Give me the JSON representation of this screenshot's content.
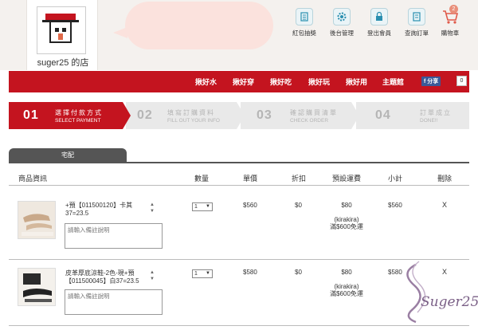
{
  "shop": {
    "name": "suger25 的店"
  },
  "top_icons": [
    {
      "label": "紅包抽獎",
      "icon": "list-icon"
    },
    {
      "label": "後台管理",
      "icon": "gear-icon"
    },
    {
      "label": "登出會員",
      "icon": "lock-icon"
    },
    {
      "label": "查詢訂單",
      "icon": "document-icon"
    },
    {
      "label": "購物車",
      "icon": "cart-icon"
    }
  ],
  "cart_count": "2",
  "nav": {
    "items": [
      "揪好水",
      "揪好穿",
      "揪好吃",
      "揪好玩",
      "揪好用",
      "主題館"
    ],
    "share_label": "分享",
    "share_count": "0"
  },
  "steps": [
    {
      "num": "01",
      "title": "選擇付款方式",
      "sub": "SELECT PAYMENT"
    },
    {
      "num": "02",
      "title": "填寫訂購資料",
      "sub": "FILL OUT YOUR INFO"
    },
    {
      "num": "03",
      "title": "確認購買清單",
      "sub": "CHECK ORDER"
    },
    {
      "num": "04",
      "title": "訂單成立",
      "sub": "DONE!!"
    }
  ],
  "tab_label": "宅配",
  "table": {
    "headers": [
      "商品資訊",
      "數量",
      "單價",
      "折扣",
      "預設運費",
      "小計",
      "刪除"
    ],
    "rows": [
      {
        "name": "+預【011500120】卡其37=23.5",
        "note_placeholder": "請輸入備註說明",
        "qty": "1",
        "price": "$560",
        "discount": "$0",
        "shipping": "$80",
        "shipping_note1": "(kirakira)",
        "shipping_note2": "滿$600免運",
        "subtotal": "$560",
        "delete": "X"
      },
      {
        "name": "皮革厚底涼鞋-2色-現+預【011500045】白37=23.5",
        "note_placeholder": "請輸入備註說明",
        "qty": "1",
        "price": "$580",
        "discount": "$0",
        "shipping": "$80",
        "shipping_note1": "(kirakira)",
        "shipping_note2": "滿$600免運",
        "subtotal": "$580",
        "delete": "X"
      }
    ]
  },
  "watermark": "Suger25",
  "colors": {
    "brand_red": "#c4141f",
    "header_bg": "#f4f1ee",
    "bubble": "#fbe2dd",
    "icon_bg": "#eaf4f7"
  }
}
